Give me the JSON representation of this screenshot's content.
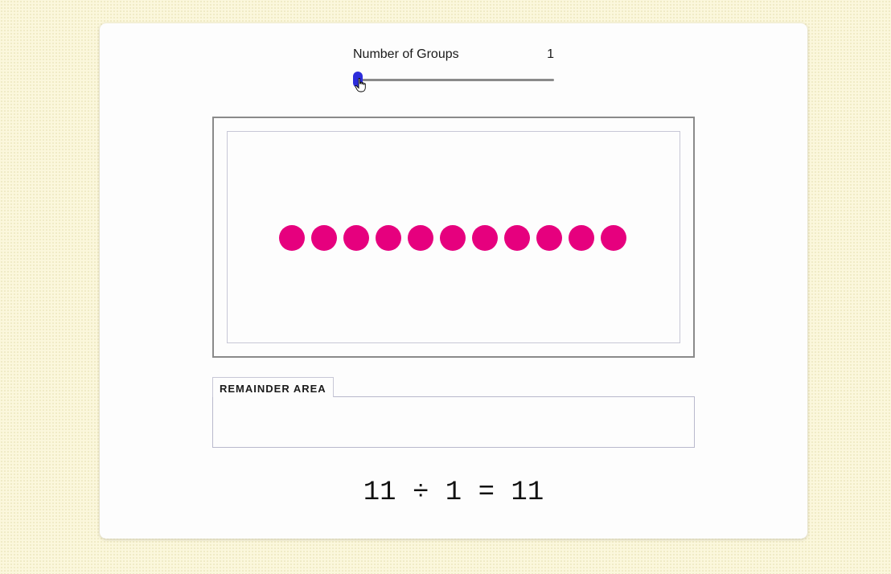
{
  "slider": {
    "label": "Number of Groups",
    "value": "1",
    "min": 1,
    "position_fraction": 0.0,
    "thumb_color": "#2d2ddb"
  },
  "groups": {
    "count": 1,
    "dot_count": 11,
    "dot_color": "#e6007e"
  },
  "remainder": {
    "label": "REMAINDER AREA"
  },
  "equation": {
    "text": "11 ÷ 1 = 11"
  },
  "icons": {
    "cursor": "hand-pointer-icon"
  }
}
